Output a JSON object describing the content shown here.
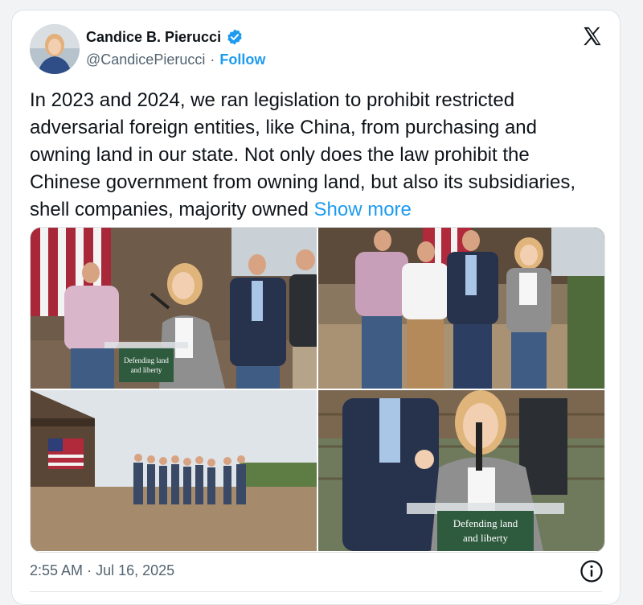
{
  "author": {
    "name": "Candice B. Pierucci",
    "handle": "@CandicePierucci",
    "separator": "·",
    "follow_label": "Follow"
  },
  "tweet": {
    "text": "In 2023 and 2024, we ran legislation to prohibit restricted adversarial foreign entities, like China, from purchasing and owning land in our state. Not only does the law prohibit the Chinese government from owning land, but also its subsidiaries, shell companies, majority owned",
    "show_more_label": "Show more"
  },
  "media": {
    "photos": [
      {
        "podium_sign": [
          "Defending land",
          "and liberty"
        ]
      },
      {},
      {},
      {
        "podium_sign": [
          "Defending land",
          "and liberty"
        ]
      }
    ]
  },
  "timestamp": {
    "time": "2:55 AM",
    "separator": "·",
    "date": "Jul 16, 2025"
  },
  "colors": {
    "accent": "#1d9bf0",
    "text_primary": "#0f1419",
    "text_secondary": "#536471",
    "podium_green": "#2e5a3e"
  },
  "icons": [
    "verified-badge-icon",
    "x-logo-icon",
    "info-icon"
  ]
}
